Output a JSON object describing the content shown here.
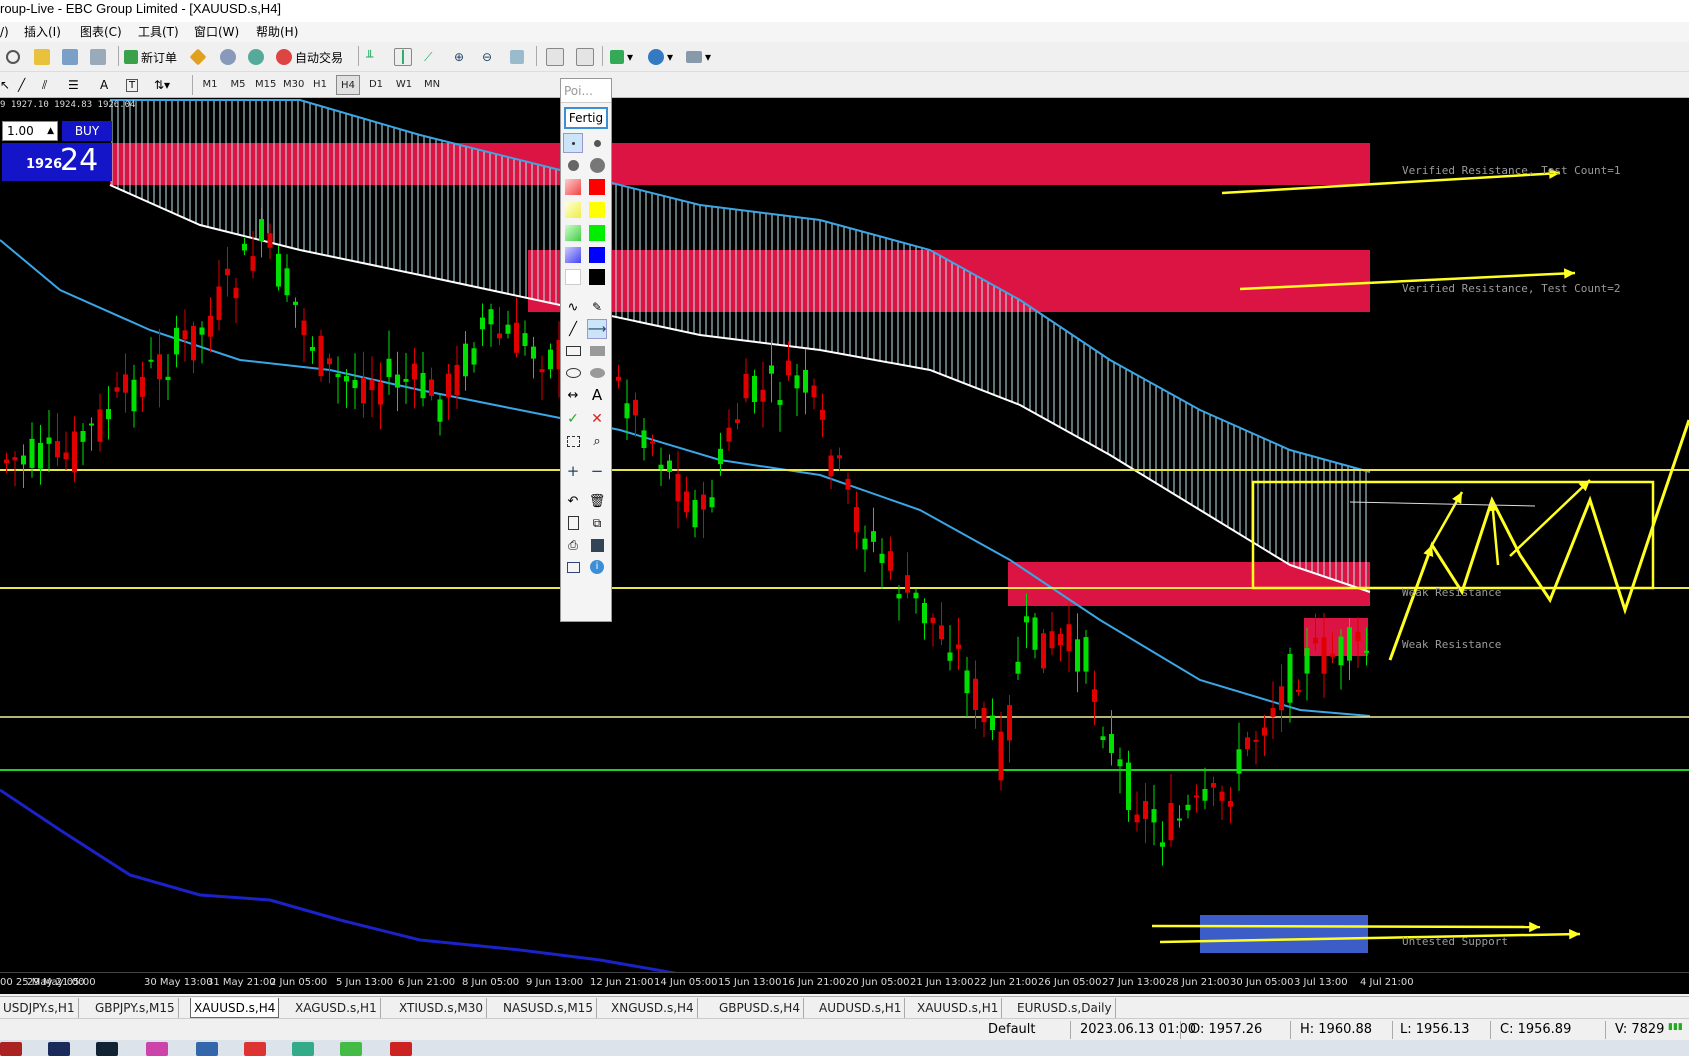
{
  "window": {
    "title": "roup-Live - EBC Group Limited - [XAUUSD.s,H4]"
  },
  "menu": {
    "items": [
      "/)",
      "插入(I)",
      "图表(C)",
      "工具(T)",
      "窗口(W)",
      "帮助(H)"
    ]
  },
  "toolbar": {
    "new_order": "新订单",
    "auto_trading": "自动交易"
  },
  "timeframes": [
    "M1",
    "M5",
    "M15",
    "M30",
    "H1",
    "H4",
    "D1",
    "W1",
    "MN"
  ],
  "active_timeframe": "H4",
  "chart": {
    "ohlc_header": "9 1927.10 1924.83 1926.04",
    "lot": "1.00",
    "buy_label": "BUY",
    "buy_price_small": "1926",
    "buy_price_big": "24",
    "zones": {
      "z1": "Verified Resistance, Test Count=1",
      "z2": "Verified Resistance, Test Count=2",
      "z3": "Weak Resistance",
      "z4": "Weak Resistance",
      "z5": "Untested Support"
    },
    "colors": {
      "zone_red": "#dc1443",
      "zone_blue": "#3c5cc8",
      "ma": "#3aa6e6",
      "bull": "#00e000",
      "bear": "#e00000",
      "hline": "#e6e64a",
      "green_line": "#22cc22"
    }
  },
  "palette": {
    "title": "Poi...",
    "done_label": "Fertig"
  },
  "xaxis": [
    "00 25 May 21:00",
    "29 May 05:00",
    "30 May 13:00",
    "31 May 21:00",
    "2 Jun 05:00",
    "5 Jun 13:00",
    "6 Jun 21:00",
    "8 Jun 05:00",
    "9 Jun 13:00",
    "12 Jun 21:00",
    "14 Jun 05:00",
    "15 Jun 13:00",
    "16 Jun 21:00",
    "20 Jun 05:00",
    "21 Jun 13:00",
    "22 Jun 21:00",
    "26 Jun 05:00",
    "27 Jun 13:00",
    "28 Jun 21:00",
    "30 Jun 05:00",
    "3 Jul 13:00",
    "4 Jul 21:00"
  ],
  "tabs": [
    "USDJPY.s,H1",
    "GBPJPY.s,M15",
    "XAUUSD.s,H4",
    "XAGUSD.s,H1",
    "XTIUSD.s,M30",
    "NASUSD.s,M15",
    "XNGUSD.s,H4",
    "GBPUSD.s,H4",
    "AUDUSD.s,H1",
    "XAUUSD.s,H1",
    "EURUSD.s,Daily"
  ],
  "active_tab": "XAUUSD.s,H4",
  "status": {
    "profile": "Default",
    "datetime": "2023.06.13 01:00",
    "open": "O: 1957.26",
    "high": "H: 1960.88",
    "low": "L: 1956.13",
    "close": "C: 1956.89",
    "volume": "V: 7829"
  }
}
